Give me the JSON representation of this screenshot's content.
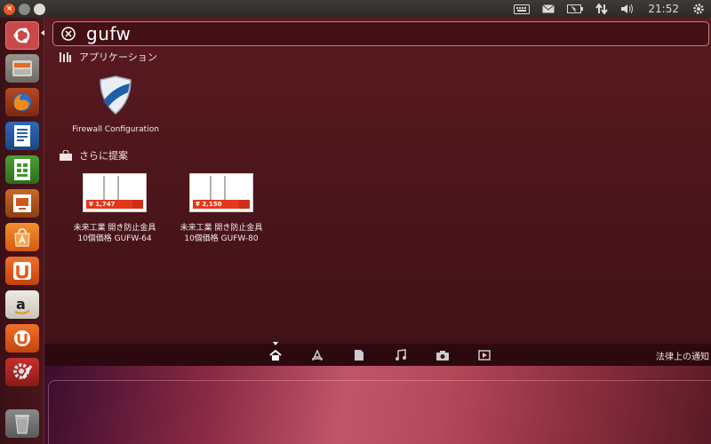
{
  "top_panel": {
    "clock": "21:52",
    "indicators": [
      "keyboard-icon",
      "mail-icon",
      "battery-icon",
      "network-icon",
      "volume-icon",
      "gear-icon"
    ]
  },
  "launcher": {
    "items": [
      {
        "name": "dash-home",
        "icon": "ubuntu-logo-icon",
        "color": "#c9494a"
      },
      {
        "name": "files",
        "icon": "file-cabinet-icon",
        "color": "#8d8a82"
      },
      {
        "name": "firefox",
        "icon": "firefox-icon",
        "color": "#e66a1c"
      },
      {
        "name": "writer",
        "icon": "writer-icon",
        "color": "#2a5ea4"
      },
      {
        "name": "calc",
        "icon": "calc-icon",
        "color": "#3f9a2e"
      },
      {
        "name": "impress",
        "icon": "impress-icon",
        "color": "#c85a1c"
      },
      {
        "name": "software-center",
        "icon": "software-center-icon",
        "color": "#f07a1e"
      },
      {
        "name": "ubuntu-one",
        "icon": "ubuntu-one-icon",
        "color": "#e65a14"
      },
      {
        "name": "amazon",
        "icon": "amazon-icon",
        "color": "#e0ddd6"
      },
      {
        "name": "ubuntu-one-music",
        "icon": "ubuntu-one-music-icon",
        "color": "#e65a14"
      },
      {
        "name": "system-settings",
        "icon": "settings-icon",
        "color": "#c92e2a"
      },
      {
        "name": "trash",
        "icon": "trash-icon",
        "color": "#7a7a7a"
      }
    ]
  },
  "search": {
    "query": "gufw"
  },
  "applications": {
    "header": "アプリケーション",
    "results": [
      {
        "label": "Firewall Configuration"
      }
    ]
  },
  "suggestions": {
    "header": "さらに提案",
    "results": [
      {
        "price": "¥ 1,747",
        "line1": "未来工業 開き防止金具",
        "line2": "10個価格 GUFW-64"
      },
      {
        "price": "¥ 2,150",
        "line1": "未来工業 開き防止金具",
        "line2": "10個価格 GUFW-80"
      }
    ]
  },
  "lens_bar": {
    "lenses": [
      "home-icon",
      "applications-icon",
      "files-icon",
      "music-icon",
      "photo-icon",
      "video-icon"
    ],
    "legal": "法律上の通知"
  },
  "colors": {
    "accent": "#e95420",
    "dash_bg": "#4e161c"
  }
}
